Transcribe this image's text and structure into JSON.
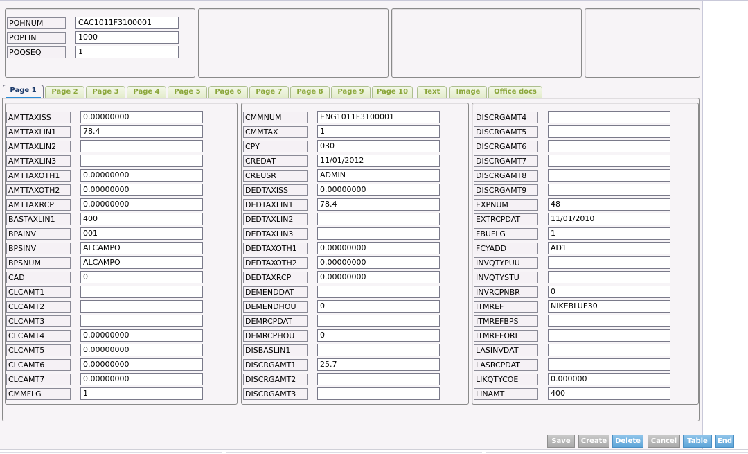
{
  "header": {
    "fields": [
      {
        "label": "POHNUM",
        "value": "CAC1011F3100001"
      },
      {
        "label": "POPLIN",
        "value": "1000"
      },
      {
        "label": "POQSEQ",
        "value": "1"
      }
    ]
  },
  "tabs": [
    {
      "label": "Page 1",
      "active": true
    },
    {
      "label": "Page 2"
    },
    {
      "label": "Page 3"
    },
    {
      "label": "Page 4"
    },
    {
      "label": "Page 5"
    },
    {
      "label": "Page 6"
    },
    {
      "label": "Page 7"
    },
    {
      "label": "Page 8"
    },
    {
      "label": "Page 9"
    },
    {
      "label": "Page 10"
    },
    {
      "label": "Text"
    },
    {
      "label": "Image"
    },
    {
      "label": "Office docs"
    }
  ],
  "columns": [
    {
      "fields": [
        {
          "label": "AMTTAXISS",
          "value": "0.00000000"
        },
        {
          "label": "AMTTAXLIN1",
          "value": "78.4"
        },
        {
          "label": "AMTTAXLIN2",
          "value": ""
        },
        {
          "label": "AMTTAXLIN3",
          "value": ""
        },
        {
          "label": "AMTTAXOTH1",
          "value": "0.00000000"
        },
        {
          "label": "AMTTAXOTH2",
          "value": "0.00000000"
        },
        {
          "label": "AMTTAXRCP",
          "value": "0.00000000"
        },
        {
          "label": "BASTAXLIN1",
          "value": "400"
        },
        {
          "label": "BPAINV",
          "value": "001"
        },
        {
          "label": "BPSINV",
          "value": "ALCAMPO"
        },
        {
          "label": "BPSNUM",
          "value": "ALCAMPO"
        },
        {
          "label": "CAD",
          "value": "0"
        },
        {
          "label": "CLCAMT1",
          "value": ""
        },
        {
          "label": "CLCAMT2",
          "value": ""
        },
        {
          "label": "CLCAMT3",
          "value": ""
        },
        {
          "label": "CLCAMT4",
          "value": "0.00000000"
        },
        {
          "label": "CLCAMT5",
          "value": "0.00000000"
        },
        {
          "label": "CLCAMT6",
          "value": "0.00000000"
        },
        {
          "label": "CLCAMT7",
          "value": "0.00000000"
        },
        {
          "label": "CMMFLG",
          "value": "1"
        }
      ]
    },
    {
      "fields": [
        {
          "label": "CMMNUM",
          "value": "ENG1011F3100001"
        },
        {
          "label": "CMMTAX",
          "value": "1"
        },
        {
          "label": "CPY",
          "value": "030"
        },
        {
          "label": "CREDAT",
          "value": "11/01/2012"
        },
        {
          "label": "CREUSR",
          "value": "ADMIN"
        },
        {
          "label": "DEDTAXISS",
          "value": "0.00000000"
        },
        {
          "label": "DEDTAXLIN1",
          "value": "78.4"
        },
        {
          "label": "DEDTAXLIN2",
          "value": ""
        },
        {
          "label": "DEDTAXLIN3",
          "value": ""
        },
        {
          "label": "DEDTAXOTH1",
          "value": "0.00000000"
        },
        {
          "label": "DEDTAXOTH2",
          "value": "0.00000000"
        },
        {
          "label": "DEDTAXRCP",
          "value": "0.00000000"
        },
        {
          "label": "DEMENDDAT",
          "value": ""
        },
        {
          "label": "DEMENDHOU",
          "value": "0"
        },
        {
          "label": "DEMRCPDAT",
          "value": ""
        },
        {
          "label": "DEMRCPHOU",
          "value": "0"
        },
        {
          "label": "DISBASLIN1",
          "value": ""
        },
        {
          "label": "DISCRGAMT1",
          "value": "25.7"
        },
        {
          "label": "DISCRGAMT2",
          "value": ""
        },
        {
          "label": "DISCRGAMT3",
          "value": ""
        }
      ]
    },
    {
      "fields": [
        {
          "label": "DISCRGAMT4",
          "value": ""
        },
        {
          "label": "DISCRGAMT5",
          "value": ""
        },
        {
          "label": "DISCRGAMT6",
          "value": ""
        },
        {
          "label": "DISCRGAMT7",
          "value": ""
        },
        {
          "label": "DISCRGAMT8",
          "value": ""
        },
        {
          "label": "DISCRGAMT9",
          "value": ""
        },
        {
          "label": "EXPNUM",
          "value": "48"
        },
        {
          "label": "EXTRCPDAT",
          "value": "11/01/2010"
        },
        {
          "label": "FBUFLG",
          "value": "1"
        },
        {
          "label": "FCYADD",
          "value": "AD1"
        },
        {
          "label": "INVQTYPUU",
          "value": ""
        },
        {
          "label": "INVQTYSTU",
          "value": ""
        },
        {
          "label": "INVRCPNBR",
          "value": "0"
        },
        {
          "label": "ITMREF",
          "value": "NIKEBLUE30"
        },
        {
          "label": "ITMREFBPS",
          "value": ""
        },
        {
          "label": "ITMREFORI",
          "value": ""
        },
        {
          "label": "LASINVDAT",
          "value": ""
        },
        {
          "label": "LASRCPDAT",
          "value": ""
        },
        {
          "label": "LIKQTYCOE",
          "value": "0.000000"
        },
        {
          "label": "LINAMT",
          "value": "400"
        }
      ]
    }
  ],
  "buttons": [
    {
      "label": "Save",
      "style": "gray"
    },
    {
      "label": "Create",
      "style": "gray"
    },
    {
      "label": "Delete",
      "style": "blue"
    },
    {
      "label": "Cancel",
      "style": "gray"
    },
    {
      "label": "Table",
      "style": "blue"
    },
    {
      "label": "End",
      "style": "blue"
    }
  ]
}
